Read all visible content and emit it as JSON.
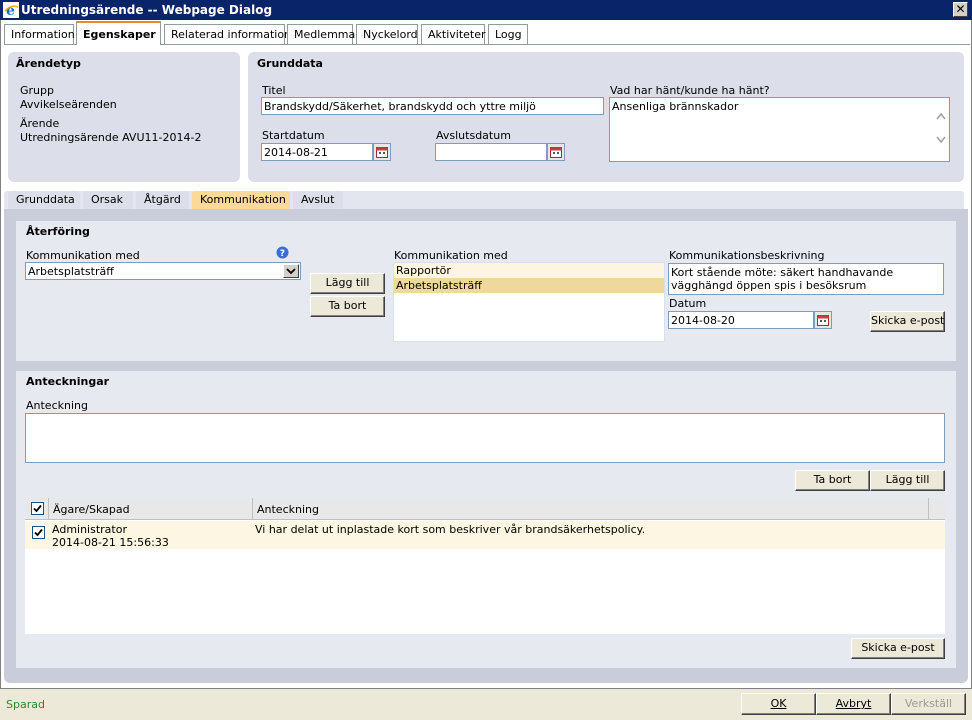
{
  "window": {
    "title": "Utredningsärende -- Webpage Dialog",
    "close_glyph": "✕"
  },
  "tabs": [
    {
      "label": "Information"
    },
    {
      "label": "Egenskaper"
    },
    {
      "label": "Relaterad information"
    },
    {
      "label": "Medlemmar"
    },
    {
      "label": "Nyckelord"
    },
    {
      "label": "Aktiviteter"
    },
    {
      "label": "Logg"
    }
  ],
  "arendetyp": {
    "header": "Ärendetyp",
    "grupp_label": "Grupp",
    "grupp_value": "Avvikelseärenden",
    "arende_label": "Ärende",
    "arende_value": "Utredningsärende AVU11-2014-2"
  },
  "grunddata": {
    "header": "Grunddata",
    "titel_label": "Titel",
    "titel_value": "Brandskydd/Säkerhet, brandskydd och yttre miljö",
    "start_label": "Startdatum",
    "start_value": "2014-08-21",
    "avslut_label": "Avslutsdatum",
    "avslut_value": "",
    "vad_label": "Vad har hänt/kunde ha hänt?",
    "vad_value": "Ansenliga brännskador"
  },
  "subtabs": [
    {
      "label": "Grunddata"
    },
    {
      "label": "Orsak"
    },
    {
      "label": "Åtgärd"
    },
    {
      "label": "Kommunikation"
    },
    {
      "label": "Avslut"
    }
  ],
  "aterforing": {
    "header": "Återföring",
    "komm_med_label": "Kommunikation med",
    "komm_med_selected": "Arbetsplatsträff",
    "help_glyph": "?",
    "lagg_till": "Lägg till",
    "ta_bort": "Ta bort",
    "list_label": "Kommunikation med",
    "list_items": [
      "Rapportör",
      "Arbetsplatsträff"
    ],
    "beskrivning_label": "Kommunikationsbeskrivning",
    "beskrivning_value": "Kort stående möte: säkert handhavande vägghängd öppen spis i besöksrum",
    "datum_label": "Datum",
    "datum_value": "2014-08-20",
    "skicka": "Skicka e-post"
  },
  "anteckningar": {
    "header": "Anteckningar",
    "anteckning_label": "Anteckning",
    "anteckning_value": "",
    "ta_bort": "Ta bort",
    "lagg_till": "Lägg till",
    "col_owner": "Ägare/Skapad",
    "col_note": "Anteckning",
    "rows": [
      {
        "owner": "Administrator",
        "created": "2014-08-21 15:56:33",
        "note": "Vi har delat ut inplastade kort som beskriver vår brandsäkerhetspolicy."
      }
    ],
    "skicka": "Skicka e-post"
  },
  "status": {
    "text": "Sparad",
    "ok": "OK",
    "avbryt": "Avbryt",
    "verkstall": "Verkställ"
  },
  "colors": {
    "titlebar": "#0a246a",
    "active_tab_accent": "#e68b2c",
    "panel": "#dcdfe9",
    "active_subtab": "#fad99a",
    "status_text": "#2b8a2b"
  }
}
